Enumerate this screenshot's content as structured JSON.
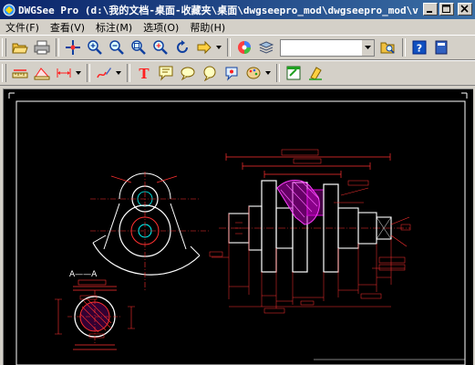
{
  "window": {
    "title": "DWGSee Pro  (d:\\我的文档-桌面-收藏夹\\桌面\\dwgseepro_mod\\dwgseepro_mod\\v..."
  },
  "menu": [
    {
      "label": "文件(F)"
    },
    {
      "label": "查看(V)"
    },
    {
      "label": "标注(M)"
    },
    {
      "label": "选项(O)"
    },
    {
      "label": "帮助(H)"
    }
  ],
  "toolbar": {
    "combo_value": ""
  },
  "drawing": {
    "section_label": "A——A",
    "accent_colors": {
      "red": "#ff0000",
      "white": "#ffffff",
      "magenta": "#cc00cc",
      "cyan": "#00ffff",
      "yellow": "#ffff00"
    }
  }
}
